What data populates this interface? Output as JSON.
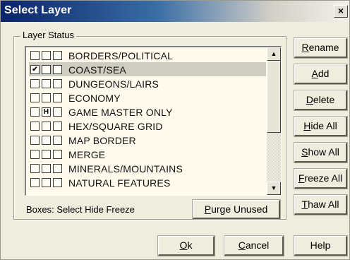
{
  "window": {
    "title": "Select Layer",
    "close_glyph": "×"
  },
  "group": {
    "legend": "Layer Status"
  },
  "layers": [
    {
      "label": "BORDERS/POLITICAL",
      "select": false,
      "hide": false,
      "freeze": false,
      "selected": false
    },
    {
      "label": "COAST/SEA",
      "select": true,
      "hide": false,
      "freeze": false,
      "selected": true
    },
    {
      "label": "DUNGEONS/LAIRS",
      "select": false,
      "hide": false,
      "freeze": false,
      "selected": false
    },
    {
      "label": "ECONOMY",
      "select": false,
      "hide": false,
      "freeze": false,
      "selected": false
    },
    {
      "label": "GAME MASTER ONLY",
      "select": false,
      "hide": true,
      "freeze": false,
      "selected": false
    },
    {
      "label": "HEX/SQUARE GRID",
      "select": false,
      "hide": false,
      "freeze": false,
      "selected": false
    },
    {
      "label": "MAP BORDER",
      "select": false,
      "hide": false,
      "freeze": false,
      "selected": false
    },
    {
      "label": "MERGE",
      "select": false,
      "hide": false,
      "freeze": false,
      "selected": false
    },
    {
      "label": "MINERALS/MOUNTAINS",
      "select": false,
      "hide": false,
      "freeze": false,
      "selected": false
    },
    {
      "label": "NATURAL FEATURES",
      "select": false,
      "hide": false,
      "freeze": false,
      "selected": false
    }
  ],
  "marks": {
    "select": "✔",
    "hide": "H"
  },
  "status": {
    "text": "Boxes: Select Hide Freeze"
  },
  "buttons": {
    "purge": {
      "hot": "P",
      "rest": "urge Unused"
    },
    "rename": {
      "hot": "R",
      "rest": "ename"
    },
    "add": {
      "hot": "A",
      "rest": "dd"
    },
    "delete": {
      "hot": "D",
      "rest": "elete"
    },
    "hide_all": {
      "hot": "H",
      "rest": "ide All"
    },
    "show_all": {
      "hot": "S",
      "rest": "how All"
    },
    "freeze_all": {
      "hot": "F",
      "rest": "reeze All"
    },
    "thaw_all": {
      "hot": "T",
      "rest": "haw All"
    },
    "ok": {
      "hot": "O",
      "rest": "k"
    },
    "cancel": {
      "hot": "C",
      "rest": "ancel"
    },
    "help": {
      "label": "Help"
    }
  },
  "scroll": {
    "up_glyph": "▲",
    "down_glyph": "▼"
  },
  "colors": {
    "title_start": "#0a246a",
    "list_background": "#fffaeb",
    "selection": "#cfcdc2"
  }
}
